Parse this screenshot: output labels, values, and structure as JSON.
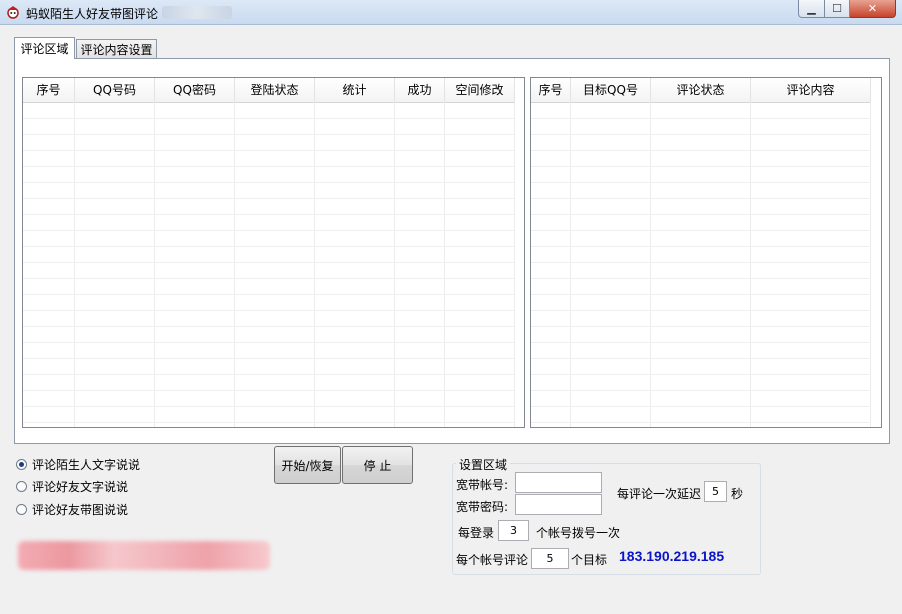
{
  "window": {
    "title": "蚂蚁陌生人好友带图评论",
    "min": "▁",
    "max": "☐",
    "close": "✕"
  },
  "tabs": [
    {
      "label": "评论区域"
    },
    {
      "label": "评论内容设置"
    }
  ],
  "left_table": {
    "columns": [
      "序号",
      "QQ号码",
      "QQ密码",
      "登陆状态",
      "统计",
      "成功",
      "空间修改"
    ],
    "rows": []
  },
  "right_table": {
    "columns": [
      "序号",
      "目标QQ号",
      "评论状态",
      "评论内容"
    ],
    "rows": []
  },
  "radios": [
    {
      "label": "评论陌生人文字说说",
      "checked": true
    },
    {
      "label": "评论好友文字说说",
      "checked": false
    },
    {
      "label": "评论好友带图说说",
      "checked": false
    }
  ],
  "buttons": {
    "start": "开始/恢复",
    "stop": "停 止"
  },
  "settings": {
    "title": "设置区域",
    "broadband_account_label": "宽带帐号:",
    "broadband_account_value": "",
    "broadband_password_label": "宽带密码:",
    "broadband_password_value": "",
    "delay_label": "每评论一次延迟",
    "delay_value": "5",
    "delay_unit": "秒",
    "login_label": "每登录",
    "login_value": "3",
    "login_suffix": "个帐号拨号一次",
    "targets_label": "每个帐号评论",
    "targets_value": "5",
    "targets_suffix": "个目标",
    "ip": "183.190.219.185"
  }
}
